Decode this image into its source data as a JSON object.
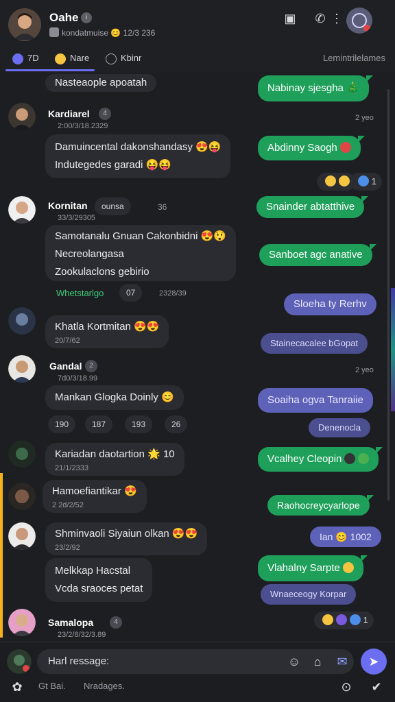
{
  "header": {
    "title": "Oahe",
    "title_badge": "i",
    "subtitle": "kondatmuise 😊 12/3 236"
  },
  "tabs": {
    "items": [
      {
        "label": "7D"
      },
      {
        "label": "Nare"
      },
      {
        "label": "Kbinr"
      }
    ],
    "right_label": "Lemintrilelames"
  },
  "messages": {
    "top_in": "Nasteaople apoatah",
    "out1": "Nabinay sjesgha 🎄",
    "m1": {
      "name": "Kardiarel",
      "badge": "4",
      "time": "2:00/3/18.2329",
      "line1": "Damuincental dakonshandasy 😍😝",
      "line2": "Indutegedes garadi 😝😝"
    },
    "time1": "2 yeo",
    "out2": "Abdinny Saogh",
    "react1": "1",
    "out3": "Snainder abtatthive",
    "m2": {
      "name": "Kornitan",
      "pill": "ounsa",
      "pill_count": "36",
      "time": "33/3/29305",
      "line1": "Samotanalu Gnuan Cakonbidni 😍😲",
      "line2": "Necreolangasa",
      "line3": "Zookulaclons gebirio",
      "link": "Whetstarlgo",
      "count": "07",
      "time2": "2328/39"
    },
    "out4": "Sanboet agc anative",
    "out5": "Sloeha ty Rerhv",
    "m3": {
      "line1": "Khatla Kortmitan 😍😍",
      "time": "20/7/62"
    },
    "out6": "Stainecacalee bGopat",
    "m4": {
      "name": "Gandal",
      "badge": "2",
      "time": "7d0/3/18.99",
      "line1": "Mankan Glogka Doinly 😊"
    },
    "time2": "2 yeo",
    "out7": "Soaiha ogva Tanraiie",
    "stats": [
      "190",
      "187",
      "193",
      "26"
    ],
    "out8": "Denenocla",
    "m5": {
      "line1": "Kariadan daotartion 🌟 10",
      "time": "21/1/2333"
    },
    "out9": "Vcalhey Cleopin",
    "m6": {
      "line1": "Hamoefiantikar 😍",
      "time": "2 2d/2/52"
    },
    "out10": "Raohocreycyarlope",
    "out11": "Ian 😊 1002",
    "m7": {
      "line1": "Shminvaoli Siyaiun olkan 😍😍",
      "time": "23/2/92"
    },
    "m8": {
      "line1": "Melkkap Hacstal",
      "line2": "Vcda sraoces petat"
    },
    "out12": "Vlahalny Sarpte",
    "out13": "Wnaeceogy Korpar",
    "m9": {
      "name": "Samalopa",
      "badge": "4",
      "time": "23/2/8/32/3.89"
    },
    "react2": "1"
  },
  "footer": {
    "input_placeholder": "Harl ressage:",
    "bottom_left": "Gt Bai.",
    "bottom_mid": "Nradages."
  },
  "colors": {
    "accent": "#6b6ef0",
    "out_green": "#1ea05a",
    "out_purple": "#5d61b8",
    "bubble_in": "#2b2c31"
  }
}
